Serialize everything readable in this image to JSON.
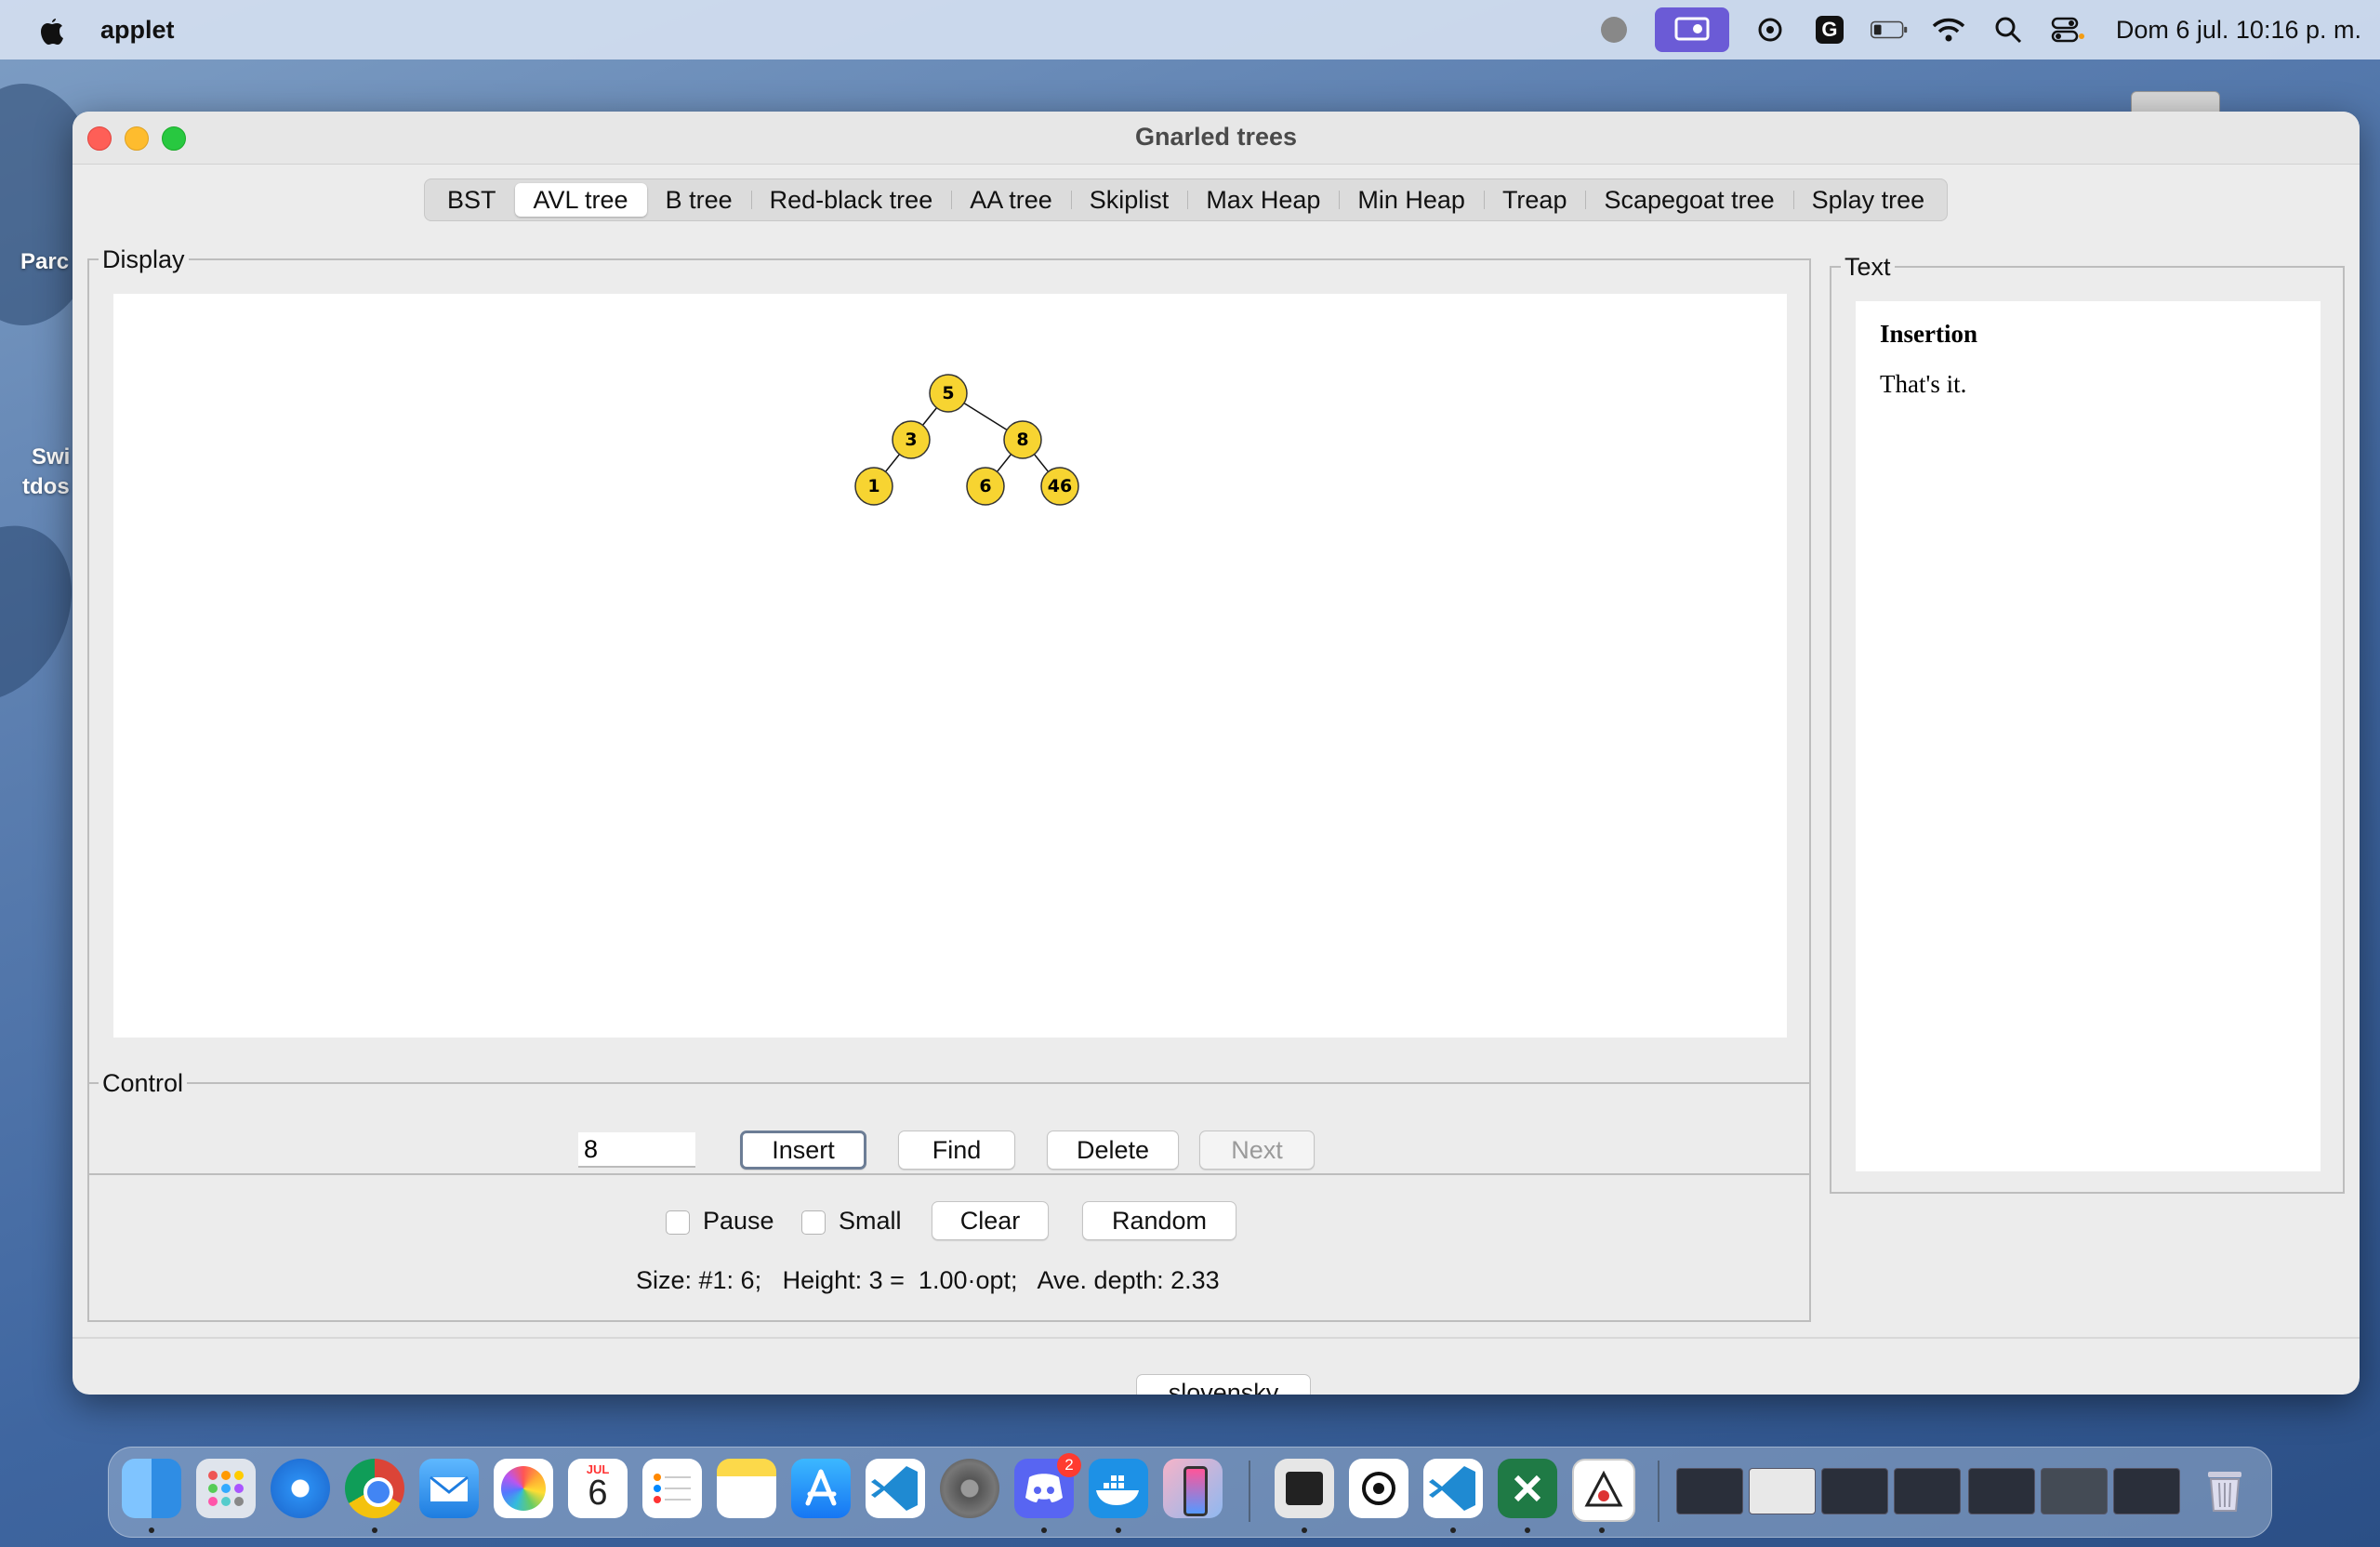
{
  "menubar": {
    "app_name": "applet",
    "datetime": "Dom 6 jul.  10:16 p. m.",
    "icons": [
      "record-icon",
      "screen-share-icon",
      "openai-icon",
      "grammarly-icon",
      "battery-icon",
      "wifi-icon",
      "search-icon",
      "control-center-icon"
    ]
  },
  "desktop": {
    "labels": [
      "Parc",
      "Swi",
      "tdos"
    ]
  },
  "window": {
    "title": "Gnarled trees",
    "tabs": [
      "BST",
      "AVL tree",
      "B tree",
      "Red-black tree",
      "AA tree",
      "Skiplist",
      "Max Heap",
      "Min Heap",
      "Treap",
      "Scapegoat tree",
      "Splay tree"
    ],
    "active_tab": "AVL tree"
  },
  "display": {
    "title": "Display",
    "tree": {
      "nodes": [
        "5",
        "3",
        "8",
        "1",
        "6",
        "46"
      ],
      "edges": [
        [
          "5",
          "3"
        ],
        [
          "5",
          "8"
        ],
        [
          "3",
          "1"
        ],
        [
          "8",
          "6"
        ],
        [
          "8",
          "46"
        ]
      ]
    }
  },
  "text_panel": {
    "title": "Text",
    "heading": "Insertion",
    "body": "That's it."
  },
  "control": {
    "title": "Control",
    "input_value": "8",
    "insert_label": "Insert",
    "find_label": "Find",
    "delete_label": "Delete",
    "next_label": "Next",
    "pause_label": "Pause",
    "small_label": "Small",
    "clear_label": "Clear",
    "random_label": "Random",
    "status": "Size: #1: 6;   Height: 3 =  1.00·opt;   Ave. depth: 2.33"
  },
  "bottom": {
    "language_button": "slovensky"
  },
  "dock": {
    "apps": [
      "finder-icon",
      "launchpad-icon",
      "safari-icon",
      "chrome-icon",
      "mail-icon",
      "photos-icon",
      "calendar-icon",
      "reminders-icon",
      "notes-icon",
      "app-store-icon",
      "vscode-icon",
      "system-settings-icon",
      "discord-icon",
      "docker-icon",
      "iphone-mirroring-icon",
      "terminal-icon",
      "chatgpt-icon",
      "vscode-icon",
      "excel-icon",
      "java-icon",
      "trash-icon"
    ],
    "calendar_month": "JUL",
    "calendar_day": "6",
    "discord_badge": "2"
  }
}
